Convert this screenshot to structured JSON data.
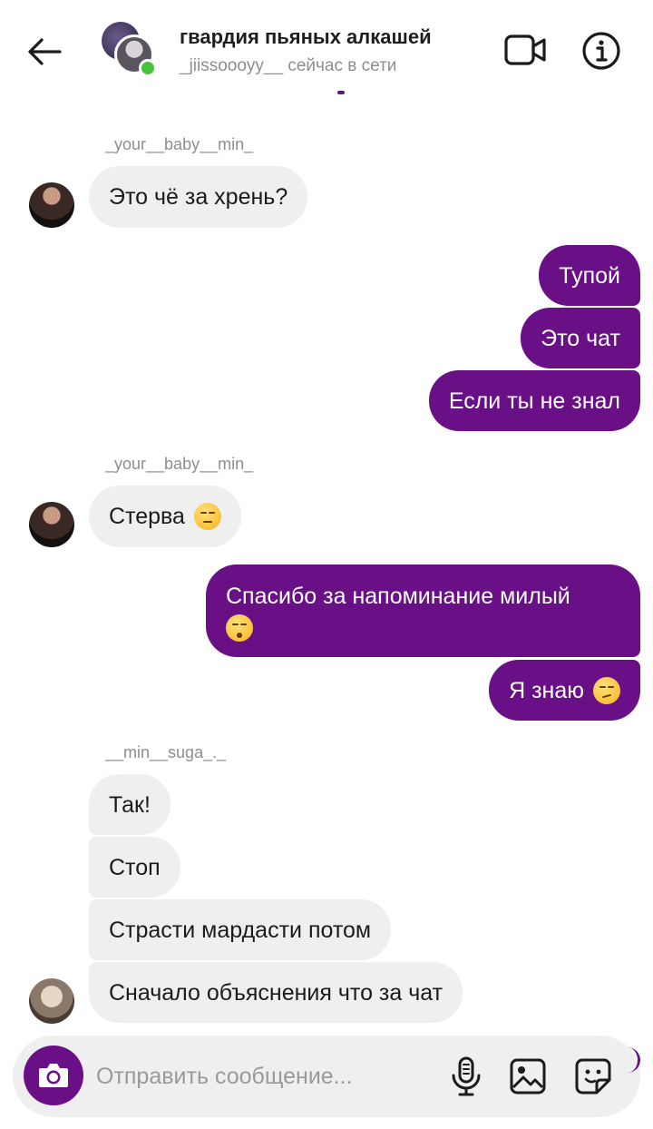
{
  "header": {
    "title": "гвардия пьяных алкашей",
    "status": "_jiissoooyy__ сейчас в сети"
  },
  "messages": [
    {
      "sender": "_your__baby__min_",
      "text": "Это чё за хрень?"
    },
    {
      "text": "Тупой"
    },
    {
      "text": "Это чат"
    },
    {
      "text": "Если ты не знал"
    },
    {
      "sender": "_your__baby__min_",
      "text": "Стерва",
      "emoji": "unamused-face-emoji"
    },
    {
      "text": "Спасибо за напоминание милый",
      "emoji": "kissing-face-emoji"
    },
    {
      "text": "Я знаю",
      "emoji": "smirking-face-emoji"
    },
    {
      "sender": "__min__suga_._",
      "text": "Так!"
    },
    {
      "text": "Стоп"
    },
    {
      "text": "Страсти мардасти потом"
    },
    {
      "text": "Сначало объяснения что за чат"
    }
  ],
  "composer": {
    "placeholder": "Отправить сообщение...",
    "icons": [
      "camera-icon",
      "microphone-icon",
      "gallery-icon",
      "sticker-icon"
    ]
  },
  "colors": {
    "accent": "#6a1087",
    "incoming_bubble": "#efefef",
    "online": "#47c23a",
    "muted_text": "#8e8e8e"
  }
}
